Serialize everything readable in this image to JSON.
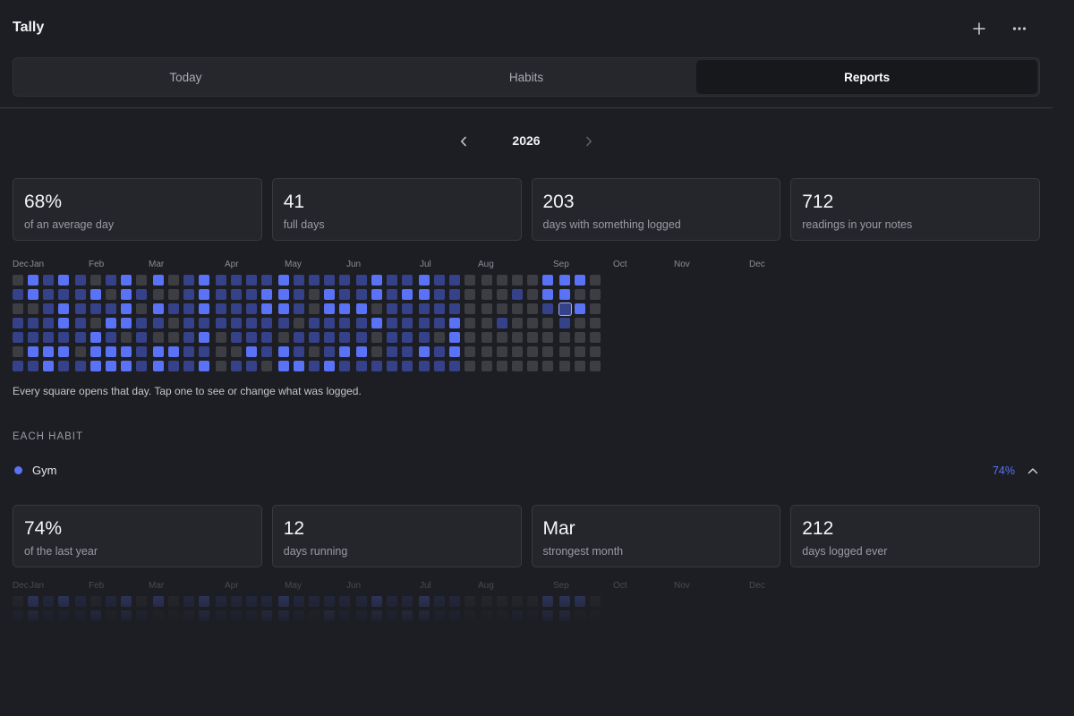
{
  "app": {
    "title": "Tally"
  },
  "header": {
    "add_icon": "plus-icon",
    "more_icon": "more-horizontal-icon"
  },
  "tabs": [
    {
      "label": "Today",
      "active": false
    },
    {
      "label": "Habits",
      "active": false
    },
    {
      "label": "Reports",
      "active": true
    }
  ],
  "year_nav": {
    "label": "2026",
    "prev_icon": "chevron-left-icon",
    "next_icon": "chevron-right-icon"
  },
  "stats": [
    {
      "value": "68%",
      "label": "of an average day"
    },
    {
      "value": "41",
      "label": "full days"
    },
    {
      "value": "203",
      "label": "days with something logged"
    },
    {
      "value": "712",
      "label": "readings in your notes"
    }
  ],
  "heatmap": {
    "months": [
      "Dec",
      "Jan",
      "Feb",
      "Mar",
      "Apr",
      "May",
      "Jun",
      "Jul",
      "Aug",
      "Sep",
      "Oct",
      "Nov",
      "Dec"
    ],
    "levels": [
      "0101101100010",
      "2201121110202",
      "1111122011321",
      "2122121021101",
      "1111101211101",
      "0210222010100",
      "1012122012121",
      "2222022120110",
      "0101111110111",
      "2021022022211",
      "0010021111000",
      "1111111111000",
      "2221212122100",
      "1111000000111",
      "1111101111011",
      "1111121121111",
      "1221110011111",
      "2221022021101",
      "1110112211111",
      "1001101111001",
      "1221112221111",
      "1121121211001",
      "1121121110012",
      "2202001120010",
      "1111111211100",
      "1211111121111",
      "2211121111111",
      "1111011111011",
      "1112221111111",
      "0000000000000",
      "0000000100000",
      "0001000000000",
      "0100000000000",
      "0000000000000",
      "2210000000000",
      "2211000000000",
      "2020000000000",
      "0000000000000"
    ],
    "today": {
      "week": 35,
      "day": 2
    },
    "colors": [
      "#3d3e44",
      "#35428a",
      "#5a72f5"
    ],
    "note": "Every square opens that day. Tap one to see or change what was logged."
  },
  "each_habit": {
    "section_title": "EACH HABIT",
    "habits": [
      {
        "name": "Gym",
        "color": "#5a72f5",
        "percent": "74%",
        "expanded": true,
        "toggle_icon": "chevron-up-icon",
        "stats": [
          {
            "value": "74%",
            "label": "of the last year"
          },
          {
            "value": "12",
            "label": "days running"
          },
          {
            "value": "Mar",
            "label": "strongest month"
          },
          {
            "value": "212",
            "label": "days logged ever"
          }
        ]
      }
    ]
  },
  "accent_color": "#5a72f5"
}
